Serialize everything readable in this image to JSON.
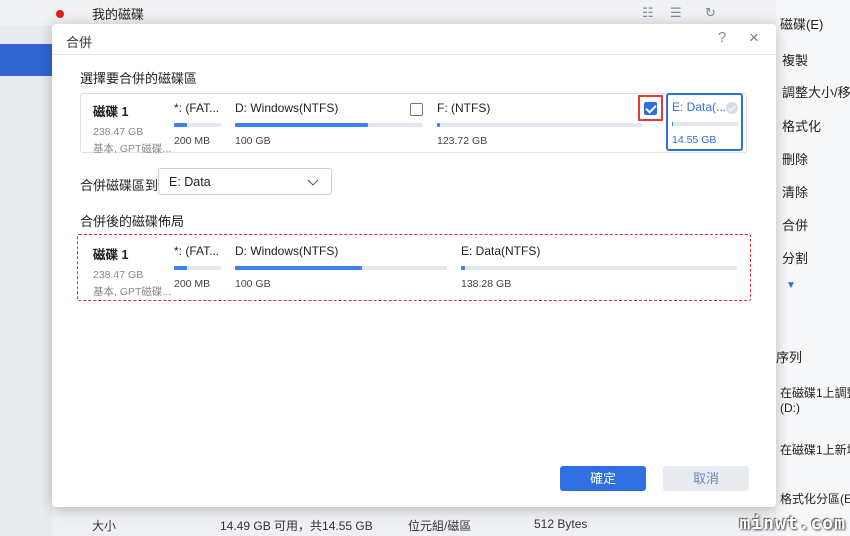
{
  "background": {
    "header_title": "我的磁碟",
    "right_panel": {
      "items": [
        "磁碟(E)",
        "複製",
        "調整大小/移",
        "格式化",
        "刪除",
        "清除",
        "合併",
        "分割"
      ],
      "more_arrow": "▼",
      "queue_label": "序列",
      "queue_items": [
        "在磁碟1上調整",
        "(D:)",
        "在磁碟1上新增",
        "格式化分區(E"
      ]
    },
    "bottom_bar": {
      "size_label": "大小",
      "size_value": "14.49 GB 可用，共14.55 GB",
      "cluster_label": "位元組/磁區",
      "cluster_value": "512 Bytes"
    },
    "watermark": "minwt.com"
  },
  "dialog": {
    "title": "合併",
    "help": "?",
    "close": "×",
    "select_label": "選擇要合併的磁碟區",
    "source_disk": {
      "name": "磁碟 1",
      "size": "238.47 GB",
      "type": "基本, GPT磁碟...",
      "partitions": [
        {
          "name": "*: (FAT...",
          "size": "200 MB",
          "usage": 0.28
        },
        {
          "name": "D: Windows(NTFS)",
          "size": "100 GB",
          "usage": 0.71
        },
        {
          "name": "F: (NTFS)",
          "size": "123.72 GB",
          "usage": 0.0,
          "checked": true
        },
        {
          "name": "E: Data(...",
          "size": "14.55 GB",
          "usage": 0.02,
          "selected": true
        }
      ]
    },
    "merge_to_label": "合併磁碟區到:",
    "merge_to_value": "E: Data",
    "layout_label": "合併後的磁碟佈局",
    "result_disk": {
      "name": "磁碟 1",
      "size": "238.47 GB",
      "type": "基本, GPT磁碟...",
      "partitions": [
        {
          "name": "*: (FAT...",
          "size": "200 MB",
          "usage": 0.28
        },
        {
          "name": "D: Windows(NTFS)",
          "size": "100 GB",
          "usage": 0.6
        },
        {
          "name": "E: Data(NTFS)",
          "size": "138.28 GB",
          "usage": 0.0
        }
      ]
    },
    "ok_label": "確定",
    "cancel_label": "取消"
  },
  "colors": {
    "accent": "#2f6fe0",
    "highlight_red": "#e03030",
    "cancel_text": "#6f88b8"
  }
}
